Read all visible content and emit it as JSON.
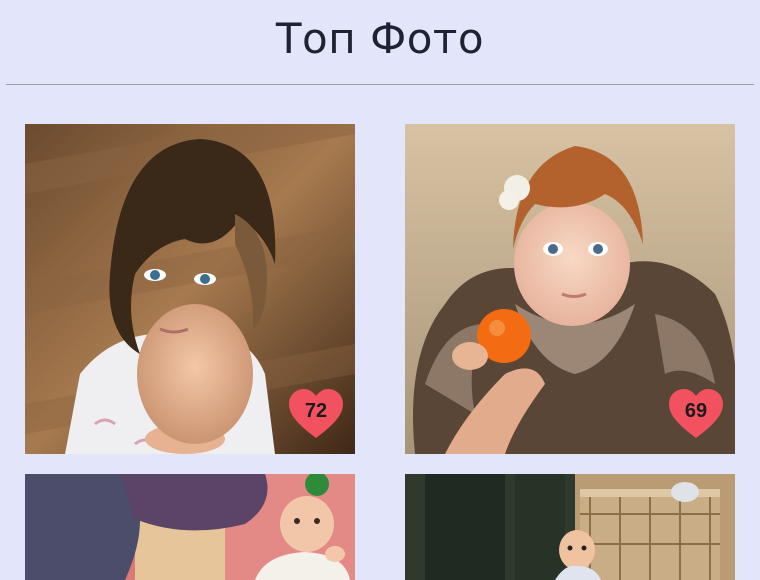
{
  "header": {
    "title": "Топ Фото"
  },
  "photos": [
    {
      "likes": "72",
      "heart_color": "#f2525f",
      "theme": "girl-on-wood-floor"
    },
    {
      "likes": "69",
      "heart_color": "#f2525f",
      "theme": "child-in-fur-with-orange"
    },
    {
      "likes": "",
      "theme": "baby-on-playmat"
    },
    {
      "likes": "",
      "theme": "baby-in-playpen"
    }
  ]
}
